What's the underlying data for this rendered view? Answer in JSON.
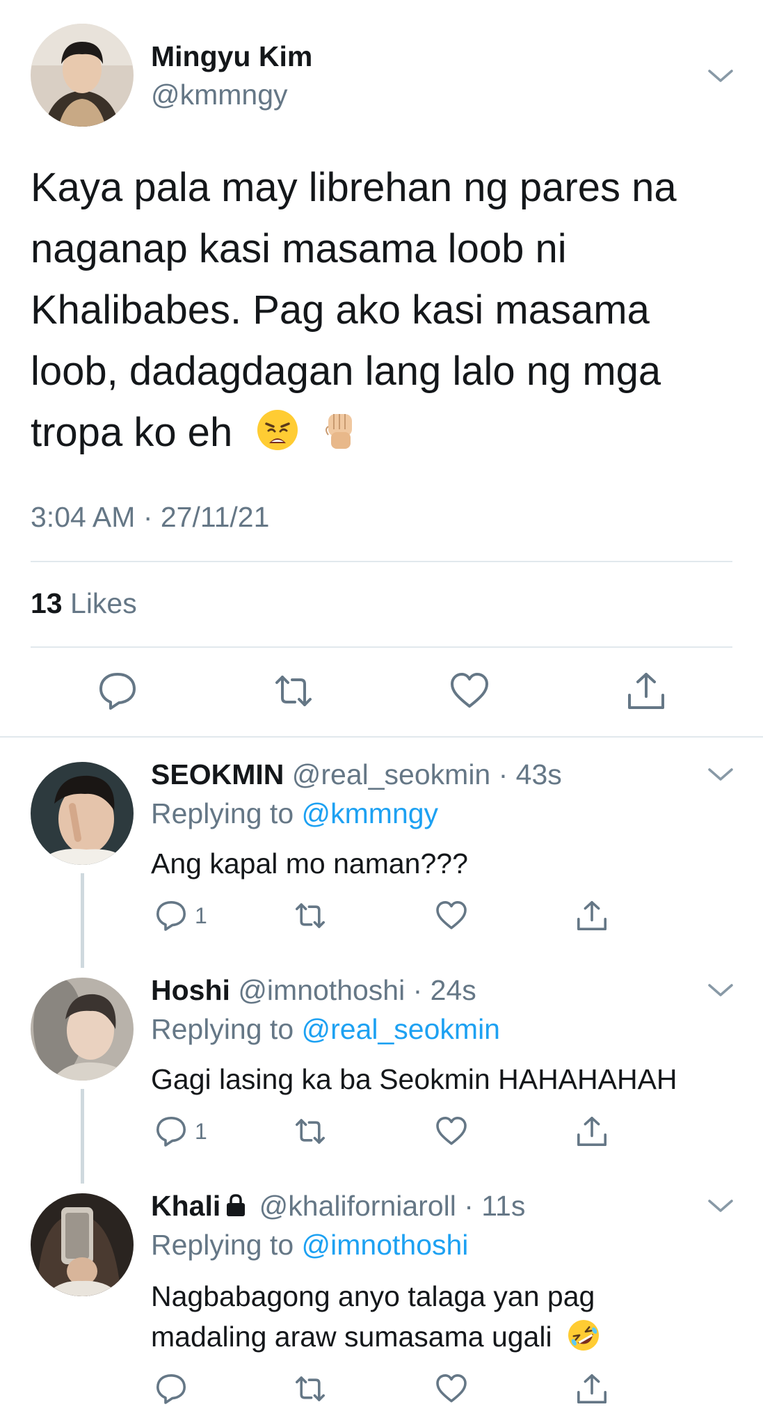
{
  "main_tweet": {
    "author_name": "Mingyu Kim",
    "author_handle": "@kmmngy",
    "text_lines": [
      "Kaya pala may librehan ng pares na",
      "naganap kasi masama loob ni",
      "Khalibabes. Pag ako kasi masama",
      "loob, dadagdagan lang lalo ng mga",
      "tropa ko eh"
    ],
    "emojis": [
      "weary-face-emoji",
      "raised-fist-emoji"
    ],
    "timestamp": "3:04 AM · 27/11/21",
    "likes_count": "13",
    "likes_label": "Likes"
  },
  "replies": [
    {
      "name": "SEOKMIN",
      "handle": "@real_seokmin · 43s",
      "replying_prefix": "Replying to ",
      "replying_to": "@kmmngy",
      "text": "Ang kapal mo naman???",
      "reply_count": "1"
    },
    {
      "name": "Hoshi",
      "handle": "@imnothoshi · 24s",
      "replying_prefix": "Replying to ",
      "replying_to": "@real_seokmin",
      "text": "Gagi lasing ka ba Seokmin HAHAHAHAH",
      "reply_count": "1"
    },
    {
      "name": "Khali",
      "handle": "@khaliforniaroll · 11s",
      "replying_prefix": "Replying to ",
      "replying_to": "@imnothoshi",
      "text_line1": "Nagbabagong anyo talaga yan pag",
      "text_line2": "madaling araw sumasama ugali",
      "emoji": "rolling-on-floor-laughing-emoji",
      "locked": true
    }
  ],
  "colors": {
    "text": "#14171a",
    "secondary": "#657786",
    "link": "#1da1f2",
    "divider": "#e1e8ed",
    "icon": "#657786"
  }
}
